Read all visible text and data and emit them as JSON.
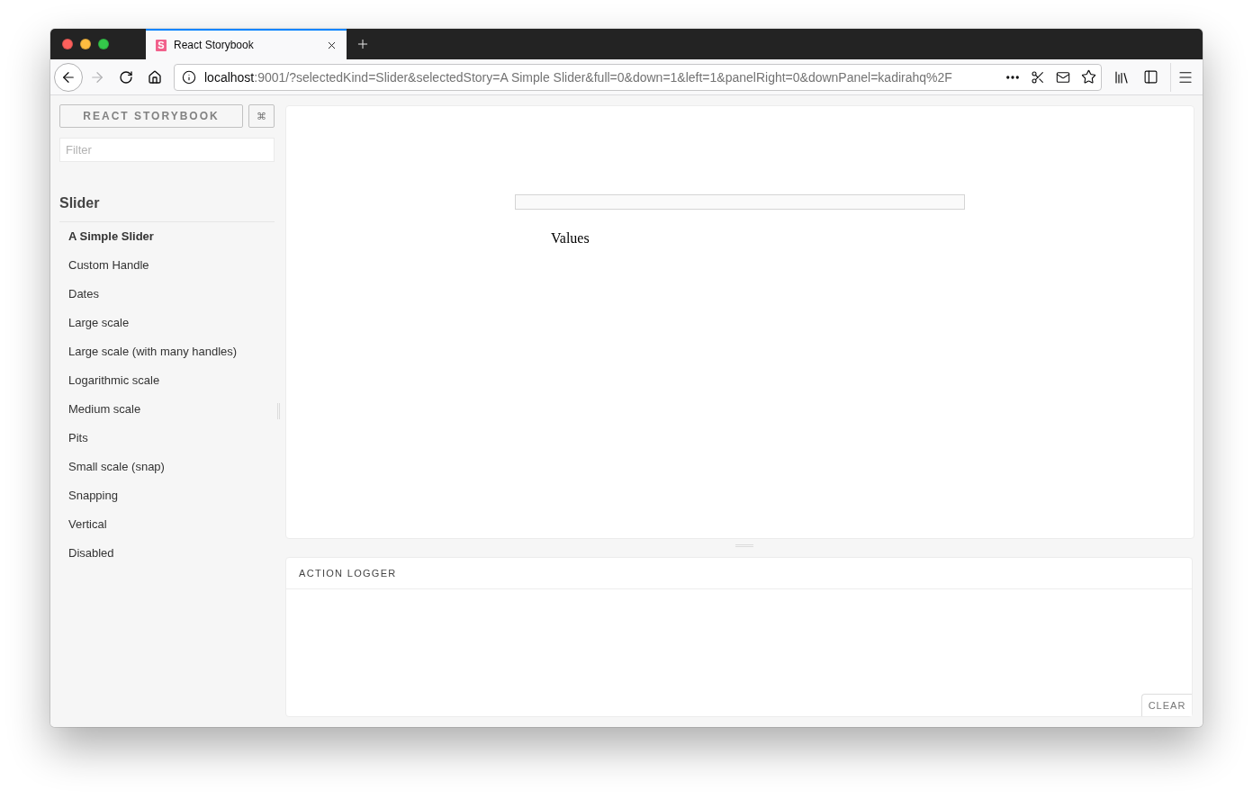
{
  "browser": {
    "tabs": [
      {
        "title": "React Storybook",
        "favicon": "S",
        "selected": true
      }
    ],
    "navigation": {
      "back": {
        "disabled": false
      },
      "forward": {
        "disabled": true
      }
    },
    "address_bar": {
      "host": "localhost",
      "rest": ":9001/?selectedKind=Slider&selectedStory=A Simple Slider&full=0&down=1&left=1&panelRight=0&downPanel=kadirahq%2F"
    }
  },
  "sidebar": {
    "title_button": "REACT STORYBOOK",
    "shortcut_button": "⌘",
    "filter": {
      "placeholder": "Filter"
    },
    "kinds": [
      {
        "title": "Slider",
        "stories": [
          {
            "label": "A Simple Slider",
            "selected": true
          },
          {
            "label": "Custom Handle",
            "selected": false
          },
          {
            "label": "Dates",
            "selected": false
          },
          {
            "label": "Large scale",
            "selected": false
          },
          {
            "label": "Large scale (with many handles)",
            "selected": false
          },
          {
            "label": "Logarithmic scale",
            "selected": false
          },
          {
            "label": "Medium scale",
            "selected": false
          },
          {
            "label": "Pits",
            "selected": false
          },
          {
            "label": "Small scale (snap)",
            "selected": false
          },
          {
            "label": "Snapping",
            "selected": false
          },
          {
            "label": "Vertical",
            "selected": false
          },
          {
            "label": "Disabled",
            "selected": false
          }
        ]
      }
    ]
  },
  "preview": {
    "values_label": "Values"
  },
  "addon_panel": {
    "title": "ACTION LOGGER",
    "clear_button": "CLEAR"
  }
}
